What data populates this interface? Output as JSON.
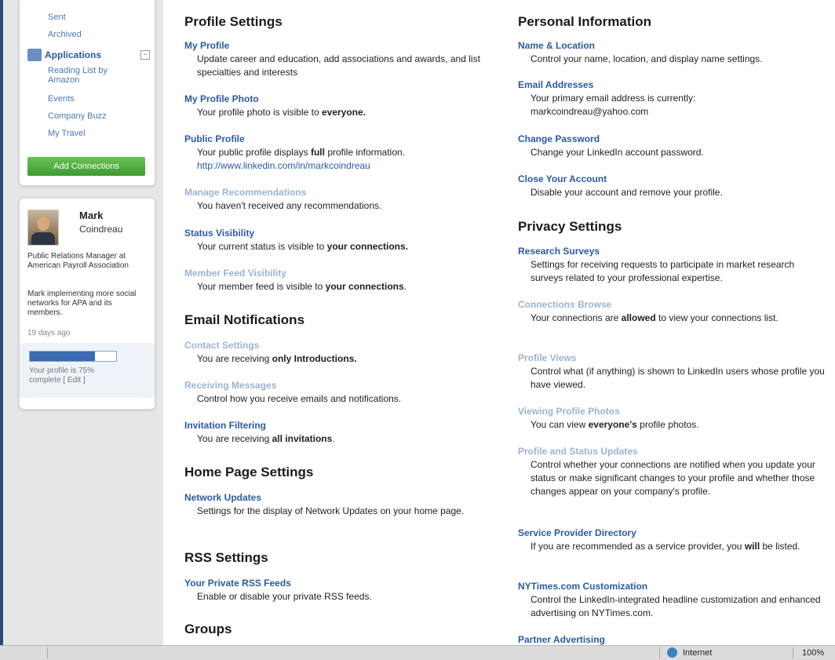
{
  "sidebar": {
    "mail": [
      "Sent",
      "Archived"
    ],
    "applications_label": "Applications",
    "applications_toggle": "−",
    "apps": [
      "Reading List by Amazon",
      "Events",
      "Company Buzz",
      "My Travel"
    ],
    "add_connections": "Add Connections",
    "profile": {
      "first_name": "Mark",
      "last_name": "Coindreau",
      "title": "Public Relations Manager at American Payroll Association",
      "status": "Mark implementing more social networks for APA and its members.",
      "status_age": "19 days ago",
      "completion": "Your profile is 75% complete [ Edit ]",
      "completion_fraction": 0.75
    }
  },
  "profile_settings": {
    "heading": "Profile Settings",
    "items": [
      {
        "title": "My Profile",
        "desc": "Update career and education, add associations and awards, and list specialties and interests"
      },
      {
        "title": "My Profile Photo",
        "desc_pre": "Your profile photo is visible to ",
        "desc_bold": "everyone."
      },
      {
        "title": "Public Profile",
        "desc_pre": "Your public profile displays ",
        "desc_bold": "full",
        "desc_post": " profile information.",
        "desc_link": "http://www.linkedin.com/in/markcoindreau"
      },
      {
        "title": "Manage Recommendations",
        "desc": "You haven't received any recommendations."
      },
      {
        "title": "Status Visibility",
        "desc_pre": "Your current status is visible to ",
        "desc_bold": "your connections."
      },
      {
        "title": "Member Feed Visibility",
        "desc_pre": "Your member feed is visible to ",
        "desc_bold": "your connections",
        "desc_post": "."
      }
    ]
  },
  "email_notifications": {
    "heading": "Email Notifications",
    "items": [
      {
        "title": "Contact Settings",
        "desc_pre": "You are receiving ",
        "desc_bold": "only Introductions."
      },
      {
        "title": "Receiving Messages",
        "desc": "Control how you receive emails and notifications."
      },
      {
        "title": "Invitation Filtering",
        "desc_pre": "You are receiving ",
        "desc_bold": "all invitations",
        "desc_post": "."
      }
    ]
  },
  "home_page_settings": {
    "heading": "Home Page Settings",
    "items": [
      {
        "title": "Network Updates",
        "desc": "Settings for the display of Network Updates on your home page."
      }
    ]
  },
  "rss_settings": {
    "heading": "RSS Settings",
    "items": [
      {
        "title": "Your Private RSS Feeds",
        "desc": "Enable or disable your private RSS feeds."
      }
    ]
  },
  "groups": {
    "heading": "Groups"
  },
  "personal_information": {
    "heading": "Personal Information",
    "items": [
      {
        "title": "Name & Location",
        "desc": "Control your name, location, and display name settings."
      },
      {
        "title": "Email Addresses",
        "desc": "Your primary email address is currently: markcoindreau@yahoo.com"
      },
      {
        "title": "Change Password",
        "desc": "Change your LinkedIn account password."
      },
      {
        "title": "Close Your Account",
        "desc": "Disable your account and remove your profile."
      }
    ]
  },
  "privacy_settings": {
    "heading": "Privacy Settings",
    "items": [
      {
        "title": "Research Surveys",
        "desc": "Settings for receiving requests to participate in market research surveys related to your professional expertise."
      },
      {
        "title": "Connections Browse",
        "desc_pre": "Your connections are ",
        "desc_bold": "allowed",
        "desc_post": " to view your connections list."
      },
      {
        "title": "Profile Views",
        "desc": "Control what (if anything) is shown to LinkedIn users whose profile you have viewed."
      },
      {
        "title": "Viewing Profile Photos",
        "desc_pre": "You can view ",
        "desc_bold": "everyone's",
        "desc_post": " profile photos."
      },
      {
        "title": "Profile and Status Updates",
        "desc": "Control whether your connections are notified when you update your status or make significant changes to your profile and whether those changes appear on your company's profile."
      },
      {
        "title": "Service Provider Directory",
        "desc_pre": "If you are recommended as a service provider, you ",
        "desc_bold": "will",
        "desc_post": " be listed."
      },
      {
        "title": "NYTimes.com Customization",
        "desc": "Control the LinkedIn-integrated headline customization and enhanced advertising on NYTimes.com."
      },
      {
        "title": "Partner Advertising"
      }
    ]
  },
  "statusbar": {
    "zone": "Internet",
    "zoom": "100%"
  }
}
